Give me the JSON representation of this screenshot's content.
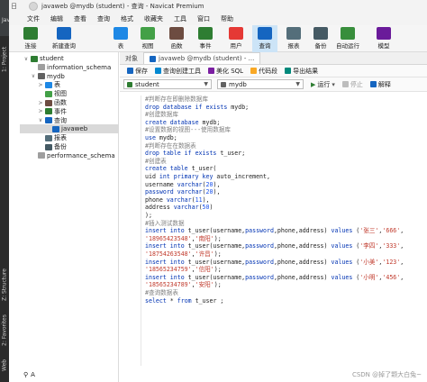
{
  "ide": {
    "top_label": "JavaW",
    "strip_tabs": [
      "1: Project",
      "Z: Structure",
      "2: Favorites",
      "Web"
    ]
  },
  "window": {
    "title": "javaweb @mydb (student) - 查询 - Navicat Premium",
    "title_prefix": "日"
  },
  "menu": [
    "文件",
    "编辑",
    "查看",
    "查询",
    "格式",
    "收藏夹",
    "工具",
    "窗口",
    "帮助"
  ],
  "toolbar": [
    {
      "label": "连接",
      "icon": "connect-icon",
      "color": "#2e7d32"
    },
    {
      "label": "新建查询",
      "icon": "new-query-icon",
      "color": "#1565c0"
    },
    {
      "label": "表",
      "icon": "table-icon",
      "color": "#1e88e5"
    },
    {
      "label": "视图",
      "icon": "view-icon",
      "color": "#43a047"
    },
    {
      "label": "函数",
      "icon": "function-icon",
      "color": "#6d4c41"
    },
    {
      "label": "事件",
      "icon": "event-icon",
      "color": "#2e7d32"
    },
    {
      "label": "用户",
      "icon": "user-icon",
      "color": "#e53935"
    },
    {
      "label": "查询",
      "icon": "query-icon",
      "color": "#1565c0",
      "active": true
    },
    {
      "label": "报表",
      "icon": "report-icon",
      "color": "#546e7a"
    },
    {
      "label": "备份",
      "icon": "backup-icon",
      "color": "#455a64"
    },
    {
      "label": "自动运行",
      "icon": "auto-run-icon",
      "color": "#388e3c"
    },
    {
      "label": "模型",
      "icon": "model-icon",
      "color": "#6a1b9a"
    }
  ],
  "tree": [
    {
      "label": "student",
      "level": 0,
      "twisty": "∨",
      "icon_color": "#2e7d32"
    },
    {
      "label": "information_schema",
      "level": 1,
      "twisty": "",
      "icon_color": "#9e9e9e"
    },
    {
      "label": "mydb",
      "level": 1,
      "twisty": "∨",
      "icon_color": "#616161"
    },
    {
      "label": "表",
      "level": 2,
      "twisty": ">",
      "icon_color": "#1e88e5"
    },
    {
      "label": "视图",
      "level": 2,
      "twisty": "",
      "icon_color": "#43a047"
    },
    {
      "label": "函数",
      "level": 2,
      "twisty": ">",
      "icon_color": "#6d4c41"
    },
    {
      "label": "事件",
      "level": 2,
      "twisty": ">",
      "icon_color": "#2e7d32"
    },
    {
      "label": "查询",
      "level": 2,
      "twisty": "∨",
      "icon_color": "#1565c0"
    },
    {
      "label": "javaweb",
      "level": 3,
      "twisty": "",
      "icon_color": "#1565c0",
      "selected": true
    },
    {
      "label": "报表",
      "level": 2,
      "twisty": "",
      "icon_color": "#546e7a"
    },
    {
      "label": "备份",
      "level": 2,
      "twisty": "",
      "icon_color": "#455a64"
    },
    {
      "label": "performance_schema",
      "level": 1,
      "twisty": "",
      "icon_color": "#9e9e9e"
    }
  ],
  "tree_search": "A",
  "tabs": [
    "对象",
    "javaweb @mydb (student) - ..."
  ],
  "query_toolbar": [
    "保存",
    "查询创建工具",
    "美化 SQL",
    "代码段",
    "导出结果"
  ],
  "connection": {
    "server": "student",
    "database": "mydb",
    "run_label": "运行",
    "stop_label": "停止",
    "explain_label": "解释"
  },
  "code": [
    [
      [
        "c",
        "#判断存在即删除数据库"
      ]
    ],
    [
      [
        "k",
        "drop database if exists "
      ],
      [
        "t",
        "mydb;"
      ]
    ],
    [
      [
        "c",
        "#创建数据库"
      ]
    ],
    [
      [
        "k",
        "create database "
      ],
      [
        "t",
        "mydb;"
      ]
    ],
    [
      [
        "c",
        "#设置数据的视图---使用数据库"
      ]
    ],
    [
      [
        "k",
        "use "
      ],
      [
        "t",
        "mydb;"
      ]
    ],
    [
      [
        "c",
        "#判断存在在数据表"
      ]
    ],
    [
      [
        "k",
        "drop table if exists "
      ],
      [
        "t",
        "t_user;"
      ]
    ],
    [
      [
        "c",
        "#创建表"
      ]
    ],
    [
      [
        "k",
        "create table "
      ],
      [
        "t",
        "t_user("
      ]
    ],
    [
      [
        "t",
        "uid "
      ],
      [
        "k",
        "int primary key "
      ],
      [
        "t",
        "auto_increment,"
      ]
    ],
    [
      [
        "t",
        "username "
      ],
      [
        "k",
        "varchar"
      ],
      [
        "t",
        "("
      ],
      [
        "n",
        "20"
      ],
      [
        "t",
        "),"
      ]
    ],
    [
      [
        "k",
        "password varchar"
      ],
      [
        "t",
        "("
      ],
      [
        "n",
        "20"
      ],
      [
        "t",
        "),"
      ]
    ],
    [
      [
        "t",
        "phone "
      ],
      [
        "k",
        "varchar"
      ],
      [
        "t",
        "("
      ],
      [
        "n",
        "11"
      ],
      [
        "t",
        "),"
      ]
    ],
    [
      [
        "t",
        "address "
      ],
      [
        "k",
        "varchar"
      ],
      [
        "t",
        "("
      ],
      [
        "n",
        "50"
      ],
      [
        "t",
        ")"
      ]
    ],
    [
      [
        "t",
        ");"
      ]
    ],
    [
      [
        "c",
        "#插入测试数据"
      ]
    ],
    [
      [
        "k",
        "insert into "
      ],
      [
        "t",
        "t_user(username,"
      ],
      [
        "k",
        "password"
      ],
      [
        "t",
        ",phone,address) "
      ],
      [
        "k",
        "values "
      ],
      [
        "t",
        "("
      ],
      [
        "s",
        "'张三'"
      ],
      [
        "t",
        ","
      ],
      [
        "s",
        "'666'"
      ],
      [
        "t",
        ","
      ]
    ],
    [
      [
        "s",
        "'18965423548'"
      ],
      [
        "t",
        ","
      ],
      [
        "s",
        "'南阳'"
      ],
      [
        "t",
        ");"
      ]
    ],
    [
      [
        "k",
        "insert into "
      ],
      [
        "t",
        "t_user(username,"
      ],
      [
        "k",
        "password"
      ],
      [
        "t",
        ",phone,address) "
      ],
      [
        "k",
        "values "
      ],
      [
        "t",
        "("
      ],
      [
        "s",
        "'李四'"
      ],
      [
        "t",
        ","
      ],
      [
        "s",
        "'333'"
      ],
      [
        "t",
        ","
      ]
    ],
    [
      [
        "s",
        "'18754263548'"
      ],
      [
        "t",
        ","
      ],
      [
        "s",
        "'许昌'"
      ],
      [
        "t",
        ");"
      ]
    ],
    [
      [
        "k",
        "insert into "
      ],
      [
        "t",
        "t_user(username,"
      ],
      [
        "k",
        "password"
      ],
      [
        "t",
        ",phone,address) "
      ],
      [
        "k",
        "values "
      ],
      [
        "t",
        "("
      ],
      [
        "s",
        "'小美'"
      ],
      [
        "t",
        ","
      ],
      [
        "s",
        "'123'"
      ],
      [
        "t",
        ","
      ]
    ],
    [
      [
        "s",
        "'18565234759'"
      ],
      [
        "t",
        ","
      ],
      [
        "s",
        "'信阳'"
      ],
      [
        "t",
        ");"
      ]
    ],
    [
      [
        "k",
        "insert into "
      ],
      [
        "t",
        "t_user(username,"
      ],
      [
        "k",
        "password"
      ],
      [
        "t",
        ",phone,address) "
      ],
      [
        "k",
        "values "
      ],
      [
        "t",
        "("
      ],
      [
        "s",
        "'小明'"
      ],
      [
        "t",
        ","
      ],
      [
        "s",
        "'456'"
      ],
      [
        "t",
        ","
      ]
    ],
    [
      [
        "s",
        "'18565234789'"
      ],
      [
        "t",
        ","
      ],
      [
        "s",
        "'安阳'"
      ],
      [
        "t",
        ");"
      ]
    ],
    [
      [
        "c",
        "#查询数据表"
      ]
    ],
    [
      [
        "k",
        "select "
      ],
      [
        "t",
        "* "
      ],
      [
        "k",
        "from "
      ],
      [
        "t",
        "t_user ;"
      ]
    ]
  ],
  "watermark": "CSDN @掉了颗大白兔~"
}
